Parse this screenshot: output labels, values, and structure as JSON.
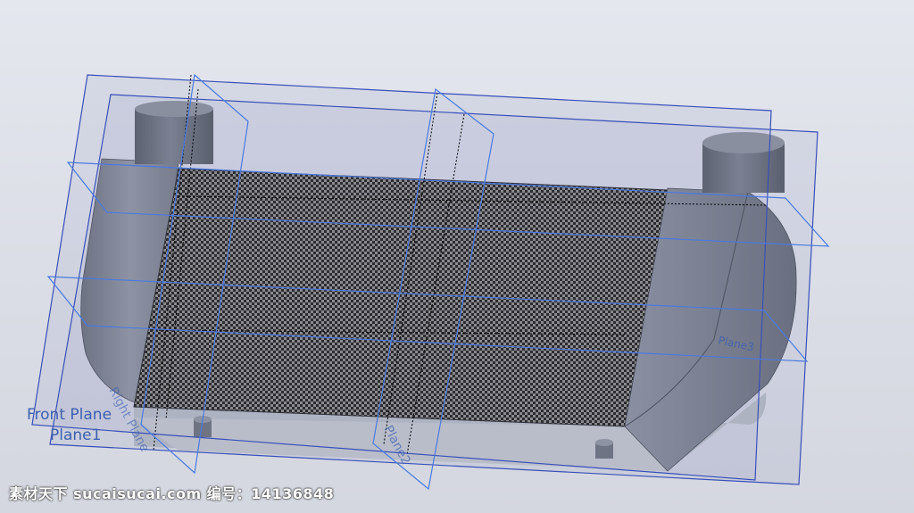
{
  "viewport": {
    "background_color": "#dde0e8",
    "plane_color": "#3a4fb8",
    "plane_label_color": "#3e5fb0",
    "body_color": "#7d8394",
    "mesh_color": "#2a2a2e"
  },
  "planes": {
    "front_plane_label": "Front Plane",
    "plane1_label": "Plane1",
    "right_plane_label": "Right Plane",
    "plane2_label": "Plane2",
    "plane3_label": "Plane3"
  },
  "watermark": {
    "text": "素材天下 sucaisucai.com  编号：14136848"
  }
}
